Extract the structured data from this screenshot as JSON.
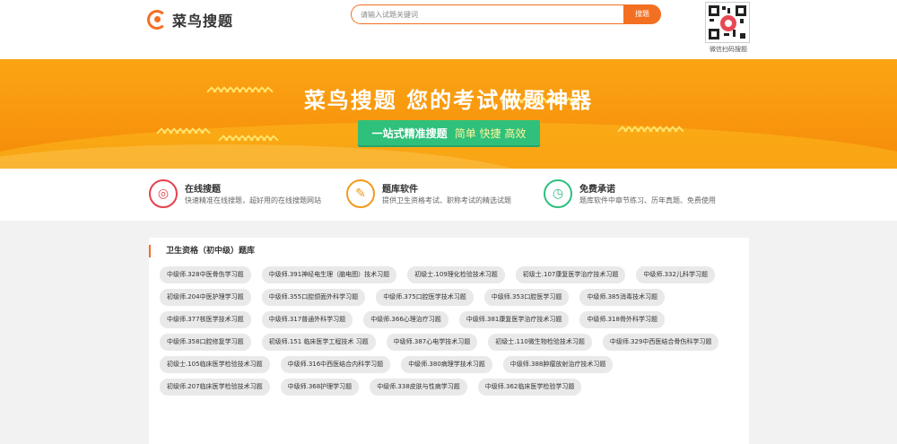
{
  "header": {
    "logo_text": "菜鸟搜题",
    "search_placeholder": "请输入试题关键词",
    "search_button": "搜题",
    "qr_caption": "微信扫码搜题"
  },
  "banner": {
    "title": "菜鸟搜题  您的考试做题神器",
    "sub_main": "一站式精准搜题",
    "sub_highlight": "简单 快捷 高效"
  },
  "features": [
    {
      "title": "在线搜题",
      "desc": "快速精准在线搜题，超好用的在线搜题网站",
      "icon": "target-icon",
      "color": "#e8404d"
    },
    {
      "title": "题库软件",
      "desc": "提供卫生资格考试、职称考试的精选试题",
      "icon": "document-edit-icon",
      "color": "#f39a1e"
    },
    {
      "title": "免费承诺",
      "desc": "题库软件中章节练习、历年真题、免费使用",
      "icon": "clock-icon",
      "color": "#2fbf7e"
    }
  ],
  "section": {
    "title": "卫生资格（初中级）题库",
    "tags": [
      "中级师.328中医骨伤学习题",
      "中级师.391神经电生理（脑电图）技术习题",
      "初级士.109理化检验技术习题",
      "初级士.107康复医学治疗技术习题",
      "中级师.332儿科学习题",
      "初级师.204中医护理学习题",
      "中级师.355口腔颌面外科学习题",
      "中级师.375口腔医学技术习题",
      "中级师.353口腔医学习题",
      "中级师.385消毒技术习题",
      "中级师.377核医学技术习题",
      "中级师.317普通外科学习题",
      "中级师.366心理治疗习题",
      "中级师.381康复医学治疗技术习题",
      "中级师.318骨外科学习题",
      "中级师.358口腔修复学习题",
      "初级师.151 临床医学工程技术 习题",
      "中级师.387心电学技术习题",
      "初级士.110微生物检验技术习题",
      "中级师.329中西医结合骨伤科学习题",
      "初级士.105临床医学检验技术习题",
      "中级师.316中西医结合内科学习题",
      "中级师.380病理学技术习题",
      "中级师.388肿瘤放射治疗技术习题",
      "初级师.207临床医学检验技术习题",
      "中级师.368护理学习题",
      "中级师.338皮肤与性病学习题",
      "中级师.362临床医学检验学习题"
    ]
  }
}
